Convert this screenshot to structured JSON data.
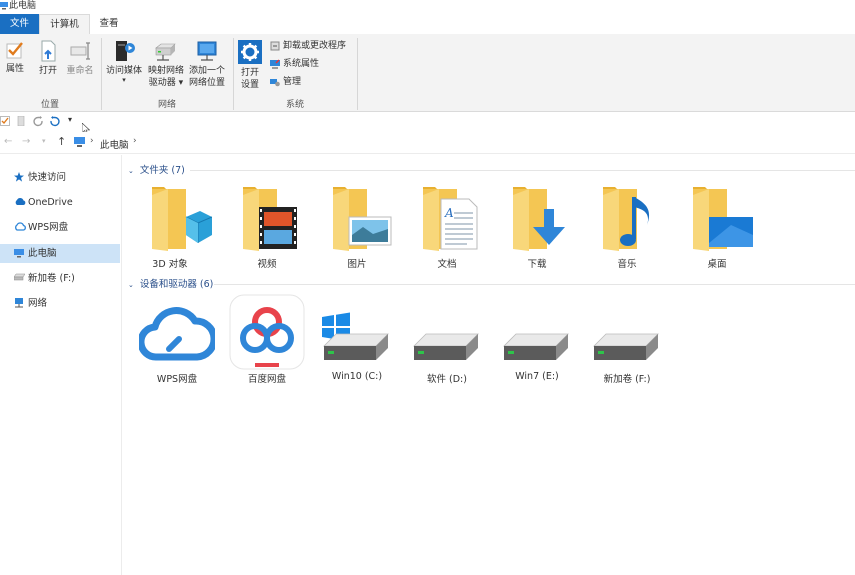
{
  "window": {
    "title": "此电脑"
  },
  "ribbon_tabs": [
    "文件",
    "计算机",
    "查看"
  ],
  "ribbon": {
    "groups": {
      "location": "位置",
      "network": "网络",
      "system": "系统"
    },
    "location_buttons": {
      "properties": "属性",
      "open": "打开",
      "rename": "重命名"
    },
    "network_buttons": {
      "access_media": "访问媒体",
      "map_drive_line1": "映射网络",
      "map_drive_line2": "驱动器",
      "add_location_line1": "添加一个",
      "add_location_line2": "网络位置"
    },
    "system_buttons": {
      "open_settings_line1": "打开",
      "open_settings_line2": "设置",
      "uninstall": "卸载或更改程序",
      "system_properties": "系统属性",
      "manage": "管理"
    }
  },
  "address_bar": {
    "path": "此电脑",
    "separator": "›"
  },
  "nav_pane": {
    "quick_access": "快速访问",
    "onedrive": "OneDrive",
    "wps_cloud": "WPS网盘",
    "this_pc": "此电脑",
    "new_volume": "新加卷 (F:)",
    "network": "网络"
  },
  "folders_section": {
    "header": "文件夹 (7)",
    "items": {
      "objects3d": "3D 对象",
      "videos": "视频",
      "pictures": "图片",
      "documents": "文档",
      "downloads": "下载",
      "music": "音乐",
      "desktop": "桌面"
    }
  },
  "devices_section": {
    "header": "设备和驱动器 (6)",
    "items": {
      "wps": "WPS网盘",
      "baidu": "百度网盘",
      "win10": "Win10 (C:)",
      "software": "软件 (D:)",
      "win7": "Win7 (E:)",
      "newvol": "新加卷 (F:)"
    }
  },
  "colors": {
    "accent": "#1a6fc2",
    "selection": "#cde3f7",
    "section_header": "#2a4f8a",
    "folder": "#f4c653"
  }
}
